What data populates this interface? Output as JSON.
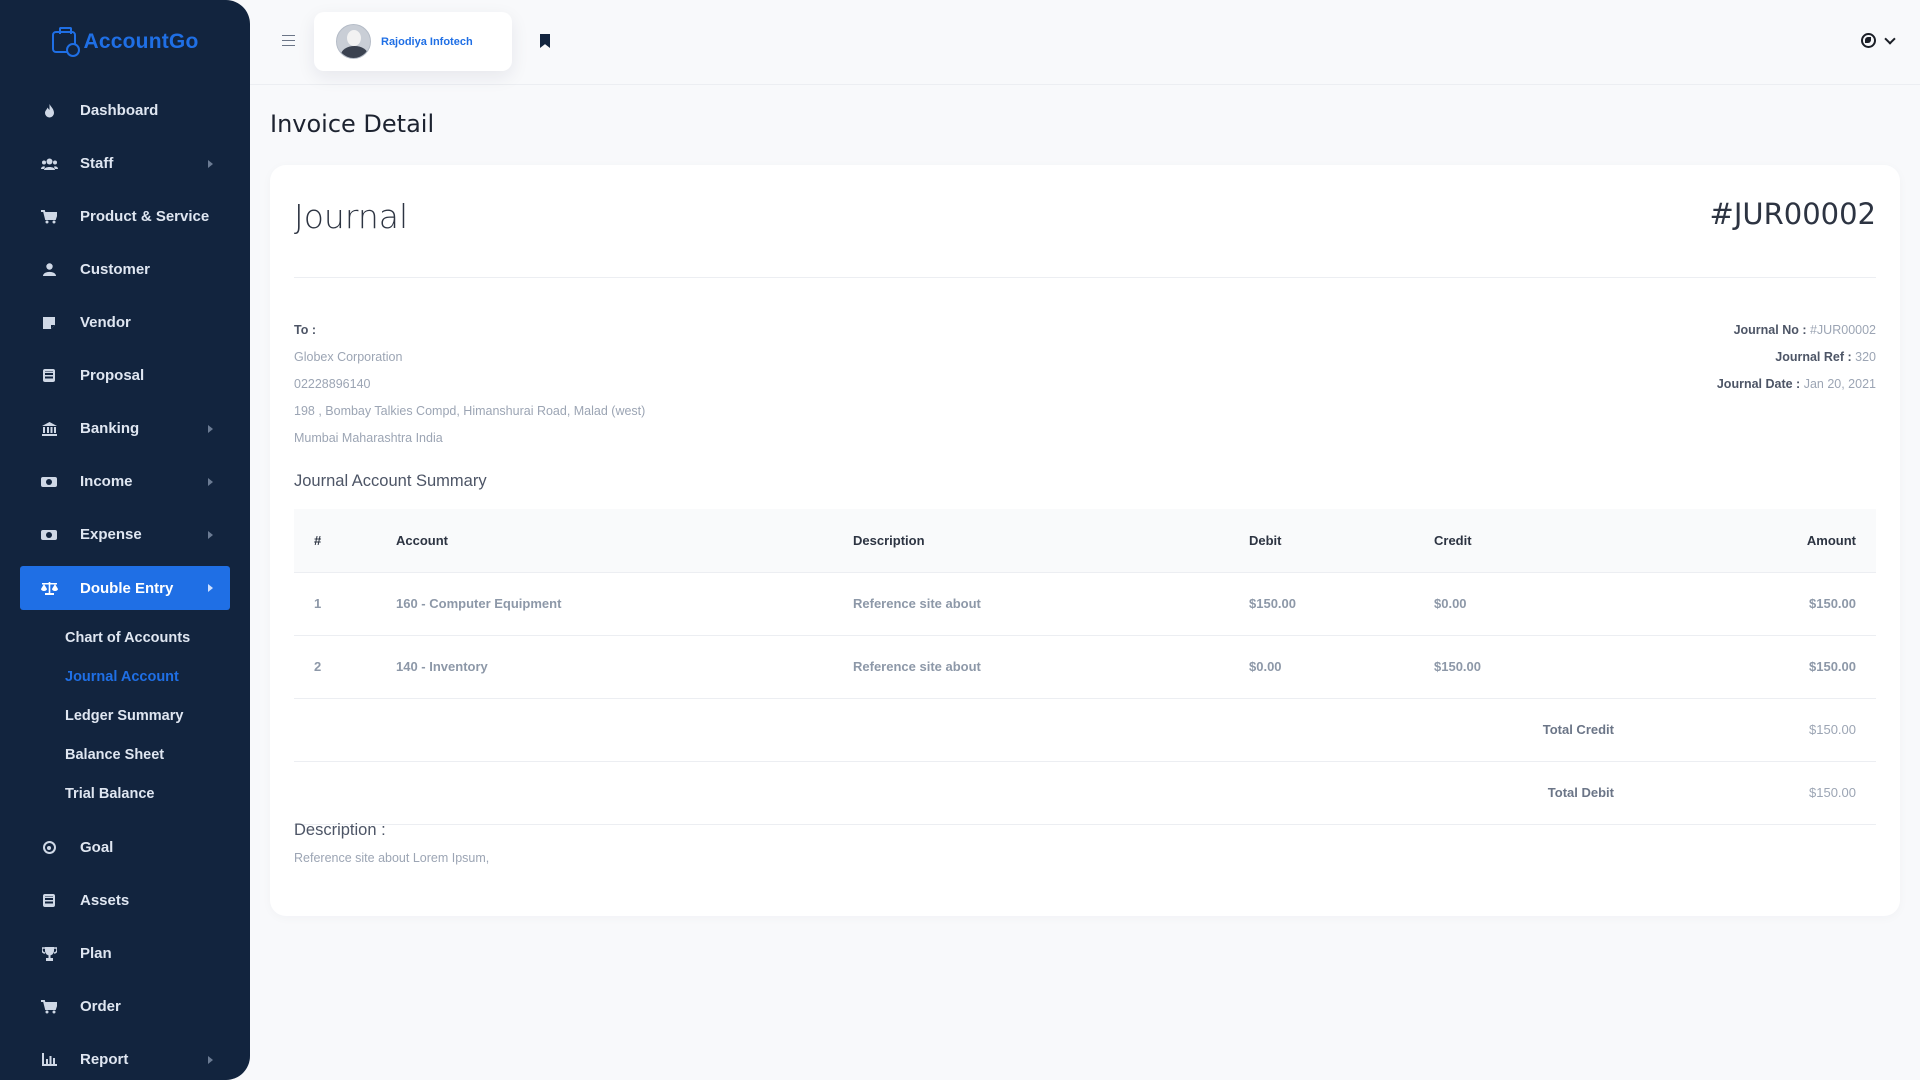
{
  "brand": {
    "name": "AccountGo"
  },
  "sidebar": {
    "items": [
      {
        "label": "Dashboard",
        "icon": "fire-icon",
        "has_submenu": false
      },
      {
        "label": "Staff",
        "icon": "users-icon",
        "has_submenu": true
      },
      {
        "label": "Product & Service",
        "icon": "cart-icon",
        "has_submenu": false
      },
      {
        "label": "Customer",
        "icon": "user-icon",
        "has_submenu": false
      },
      {
        "label": "Vendor",
        "icon": "note-icon",
        "has_submenu": false
      },
      {
        "label": "Proposal",
        "icon": "document-icon",
        "has_submenu": false
      },
      {
        "label": "Banking",
        "icon": "bank-icon",
        "has_submenu": true
      },
      {
        "label": "Income",
        "icon": "money-icon",
        "has_submenu": true
      },
      {
        "label": "Expense",
        "icon": "money-out-icon",
        "has_submenu": true
      },
      {
        "label": "Double Entry",
        "icon": "balance-scale-icon",
        "has_submenu": true,
        "active": true
      },
      {
        "label": "Goal",
        "icon": "target-icon",
        "has_submenu": false
      },
      {
        "label": "Assets",
        "icon": "calculator-icon",
        "has_submenu": false
      },
      {
        "label": "Plan",
        "icon": "trophy-icon",
        "has_submenu": false
      },
      {
        "label": "Order",
        "icon": "cart-icon",
        "has_submenu": false
      },
      {
        "label": "Report",
        "icon": "chart-icon",
        "has_submenu": true
      }
    ],
    "double_entry_sub": [
      "Chart of Accounts",
      "Journal Account",
      "Ledger Summary",
      "Balance Sheet",
      "Trial Balance"
    ],
    "current_sub": "Journal Account"
  },
  "header": {
    "user_name": "Rajodiya Infotech"
  },
  "page": {
    "title": "Invoice Detail"
  },
  "journal": {
    "title": "Journal",
    "number": "#JUR00002",
    "to_label": "To :",
    "to_lines": [
      "Globex Corporation",
      "02228896140",
      "198 , Bombay Talkies Compd, Himanshurai Road, Malad (west)",
      "Mumbai Maharashtra India"
    ],
    "meta": [
      {
        "label": "Journal No :",
        "value": "#JUR00002"
      },
      {
        "label": "Journal Ref :",
        "value": "320"
      },
      {
        "label": "Journal Date :",
        "value": "Jan 20, 2021"
      }
    ],
    "summary_title": "Journal Account Summary",
    "table": {
      "headers": [
        "#",
        "Account",
        "Description",
        "Debit",
        "Credit",
        "Amount"
      ],
      "rows": [
        [
          "1",
          "160 - Computer Equipment",
          "Reference site about",
          "$150.00",
          "$0.00",
          "$150.00"
        ],
        [
          "2",
          "140 - Inventory",
          "Reference site about",
          "$0.00",
          "$150.00",
          "$150.00"
        ]
      ],
      "totals": [
        {
          "label": "Total Credit",
          "value": "$150.00"
        },
        {
          "label": "Total Debit",
          "value": "$150.00"
        }
      ]
    },
    "description_title": "Description :",
    "description_text": "Reference site about Lorem Ipsum,"
  },
  "colors": {
    "sidebar_bg": "#12243e",
    "accent": "#1f6fe5",
    "page_bg": "#f8f9fb"
  }
}
